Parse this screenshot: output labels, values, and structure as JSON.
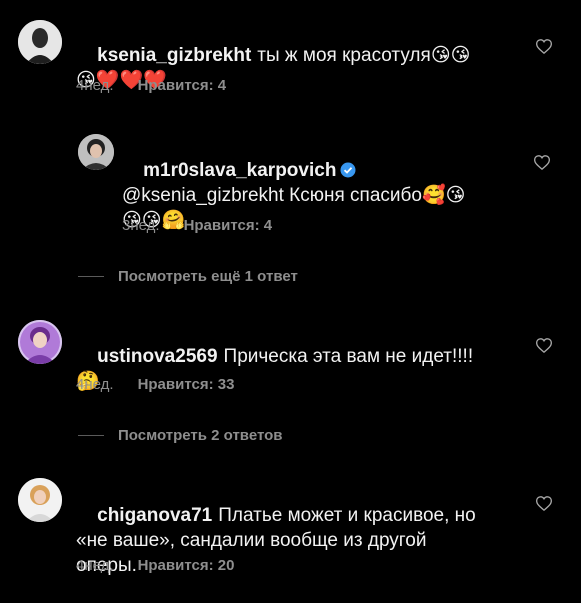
{
  "comments": [
    {
      "username": "ksenia_gizbrekht",
      "text": "ты ж моя красотуля",
      "emoji_inline": "😘😘",
      "emoji_line2": "😘❤️❤️❤️",
      "time": "4нед.",
      "likes": "Нравится: 4"
    },
    {
      "username": "m1r0slava_karpovich",
      "verified": true,
      "text": "@ksenia_gizbrekht Ксюня спасибо",
      "emoji_inline": "🥰😘",
      "emoji_line2": "😘😘🤗",
      "time": "3нед.",
      "likes": "Нравится: 4"
    },
    {
      "username": "ustinova2569",
      "text": "Прическа эта вам не идет!!!!",
      "emoji_line2": "🤔",
      "time": "4нед.",
      "likes": "Нравится: 33"
    },
    {
      "username": "chiganova71",
      "text": "Платье может и красивое, но",
      "line2": "«не ваше», сандалии вообще из другой",
      "line3": "оперы.",
      "time": "4нед.",
      "likes": "Нравится: 20"
    }
  ],
  "view_more_1": "Посмотреть ещё 1 ответ",
  "view_more_2": "Посмотреть 2 ответов",
  "colors": {
    "background": "#000000",
    "text": "#f2f2f2",
    "meta": "#8e8e8e",
    "verified": "#3897f0"
  },
  "icons": {
    "heart": "heart-outline-icon",
    "verified": "verified-badge-icon"
  }
}
